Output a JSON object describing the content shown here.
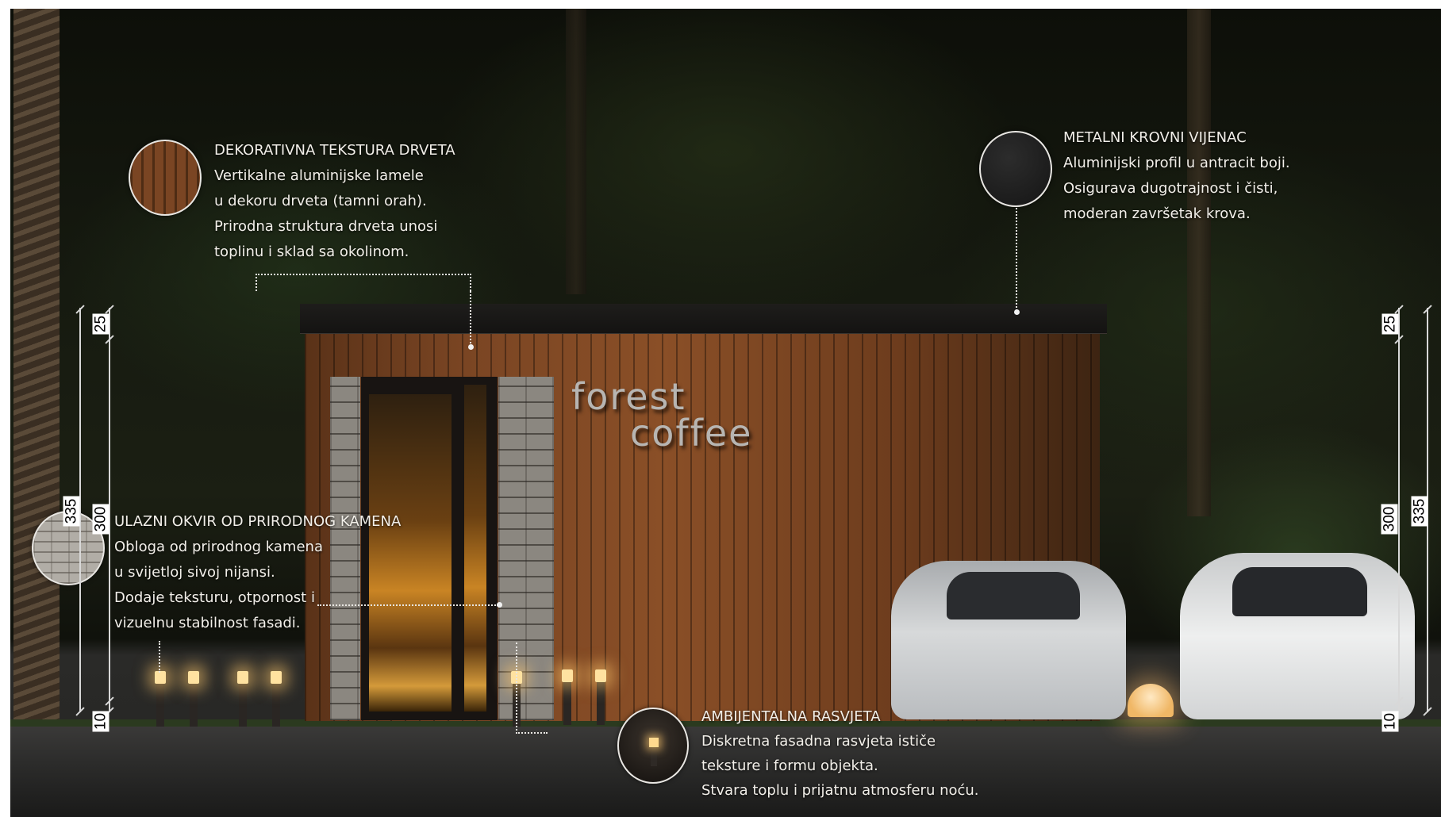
{
  "sign": {
    "line1": "forest",
    "line2": "coffee"
  },
  "annotations": {
    "wood": {
      "title": "DEKORATIVNA TEKSTURA DRVETA",
      "lines": [
        "Vertikalne aluminijske lamele",
        "u dekoru drveta (tamni orah).",
        "Prirodna struktura drveta unosi",
        "toplinu i sklad sa okolinom."
      ]
    },
    "roof": {
      "title": "METALNI KROVNI VIJENAC",
      "lines": [
        "Aluminijski profil u antracit boji.",
        "Osigurava dugotrajnost i čisti,",
        "moderan završetak krova."
      ]
    },
    "stone": {
      "title": "ULAZNI OKVIR OD PRIRODNOG KAMENA",
      "lines": [
        "Obloga od prirodnog kamena",
        "u svijetloj sivoj nijansi.",
        "Dodaje teksturu, otpornost i",
        "vizuelnu stabilnost fasadi."
      ]
    },
    "lighting": {
      "title": "AMBIJENTALNA RASVJETA",
      "lines": [
        "Diskretna fasadna rasvjeta ističe",
        "teksture i formu objekta.",
        "Stvara toplu i prijatnu atmosferu noću."
      ]
    }
  },
  "dimensions": {
    "left": {
      "top": "25",
      "wall": "300",
      "total": "335",
      "bottom": "10"
    },
    "right": {
      "top": "25",
      "wall": "300",
      "total": "335",
      "bottom": "10"
    }
  },
  "colors": {
    "wood": "#7a4523",
    "roof_trim": "#1e1d1b",
    "stone": "#8b8780",
    "light": "#ffd98e",
    "annotation_text": "#f2efe9"
  },
  "icons": {
    "wood_swatch": "wood-texture-swatch",
    "roof_swatch": "metal-roof-swatch",
    "stone_swatch": "stone-texture-swatch",
    "light_swatch": "bollard-light-swatch"
  }
}
